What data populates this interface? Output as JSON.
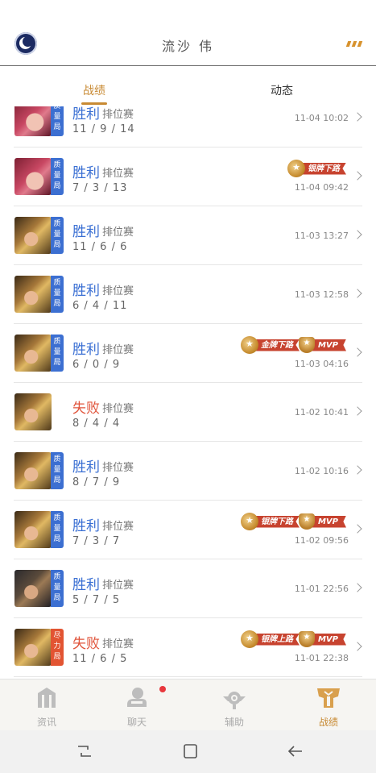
{
  "header": {
    "title": "流沙 伟"
  },
  "tabs": [
    {
      "label": "战绩",
      "active": true
    },
    {
      "label": "动态",
      "active": false
    }
  ],
  "matches": [
    {
      "result": "胜利",
      "outcome": "win",
      "mode": "排位赛",
      "kda": "11 / 9 / 14",
      "time": "11-04 10:02",
      "badge": [
        "质",
        "量",
        "局"
      ],
      "badge_color": "blue",
      "hero": "red-hair",
      "medals": []
    },
    {
      "result": "胜利",
      "outcome": "win",
      "mode": "排位赛",
      "kda": "7 / 3 / 13",
      "time": "11-04 09:42",
      "badge": [
        "质",
        "量",
        "局"
      ],
      "badge_color": "blue",
      "hero": "red-hair",
      "medals": [
        {
          "kind": "coin",
          "label": "银牌下路"
        }
      ]
    },
    {
      "result": "胜利",
      "outcome": "win",
      "mode": "排位赛",
      "kda": "11 / 6 / 6",
      "time": "11-03 13:27",
      "badge": [
        "质",
        "量",
        "局"
      ],
      "badge_color": "blue",
      "hero": "gold",
      "medals": []
    },
    {
      "result": "胜利",
      "outcome": "win",
      "mode": "排位赛",
      "kda": "6 / 4 / 11",
      "time": "11-03 12:58",
      "badge": [
        "质",
        "量",
        "局"
      ],
      "badge_color": "blue",
      "hero": "gold",
      "medals": []
    },
    {
      "result": "胜利",
      "outcome": "win",
      "mode": "排位赛",
      "kda": "6 / 0 / 9",
      "time": "11-03 04:16",
      "badge": [
        "质",
        "量",
        "局"
      ],
      "badge_color": "blue",
      "hero": "gold",
      "medals": [
        {
          "kind": "coin",
          "label": "金牌下路"
        },
        {
          "kind": "cup",
          "label": "MVP"
        }
      ]
    },
    {
      "result": "失败",
      "outcome": "lose",
      "mode": "排位赛",
      "kda": "8 / 4 / 4",
      "time": "11-02 10:41",
      "badge": [],
      "badge_color": "",
      "hero": "gold",
      "medals": []
    },
    {
      "result": "胜利",
      "outcome": "win",
      "mode": "排位赛",
      "kda": "8 / 7 / 9",
      "time": "11-02 10:16",
      "badge": [
        "质",
        "量",
        "局"
      ],
      "badge_color": "blue",
      "hero": "gold",
      "medals": []
    },
    {
      "result": "胜利",
      "outcome": "win",
      "mode": "排位赛",
      "kda": "7 / 3 / 7",
      "time": "11-02 09:56",
      "badge": [
        "质",
        "量",
        "局"
      ],
      "badge_color": "blue",
      "hero": "gold",
      "medals": [
        {
          "kind": "coin",
          "label": "银牌下路"
        },
        {
          "kind": "cup",
          "label": "MVP"
        }
      ]
    },
    {
      "result": "胜利",
      "outcome": "win",
      "mode": "排位赛",
      "kda": "5 / 7 / 5",
      "time": "11-01 22:56",
      "badge": [
        "质",
        "量",
        "局"
      ],
      "badge_color": "blue",
      "hero": "dark",
      "medals": []
    },
    {
      "result": "失败",
      "outcome": "lose",
      "mode": "排位赛",
      "kda": "11 / 6 / 5",
      "time": "11-01 22:38",
      "badge": [
        "尽",
        "力",
        "局"
      ],
      "badge_color": "red",
      "hero": "gold",
      "medals": [
        {
          "kind": "coin",
          "label": "银牌上路"
        },
        {
          "kind": "cup",
          "label": "MVP"
        }
      ]
    }
  ],
  "bottom_nav": [
    {
      "label": "资讯",
      "icon": "news-icon",
      "active": false
    },
    {
      "label": "聊天",
      "icon": "chat-icon",
      "active": false,
      "has_dot": true
    },
    {
      "label": "辅助",
      "icon": "assist-icon",
      "active": false
    },
    {
      "label": "战绩",
      "icon": "record-icon",
      "active": true
    }
  ],
  "system_nav": [
    {
      "icon": "recent-apps-icon"
    },
    {
      "icon": "home-icon"
    },
    {
      "icon": "back-icon"
    }
  ],
  "colors": {
    "accent": "#c88a33",
    "win": "#3a6fd3",
    "lose": "#e0543b",
    "badge_blue": "#3c6fd1",
    "badge_red": "#e25432"
  }
}
